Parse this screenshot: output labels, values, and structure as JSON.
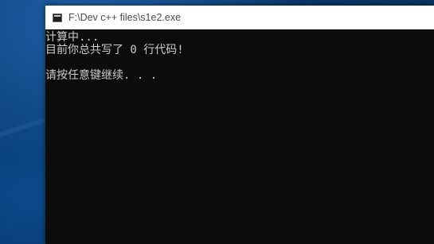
{
  "window": {
    "title": "F:\\Dev c++ files\\s1e2.exe",
    "app_icon": "console-app-icon"
  },
  "console": {
    "lines": [
      "计算中...",
      "目前你总共写了 0 行代码!",
      "",
      "请按任意键继续. . ."
    ]
  },
  "colors": {
    "console_bg": "#0c0c0c",
    "console_text": "#cccccc",
    "titlebar_bg": "#ffffff",
    "desktop": "#0a3a6e"
  }
}
